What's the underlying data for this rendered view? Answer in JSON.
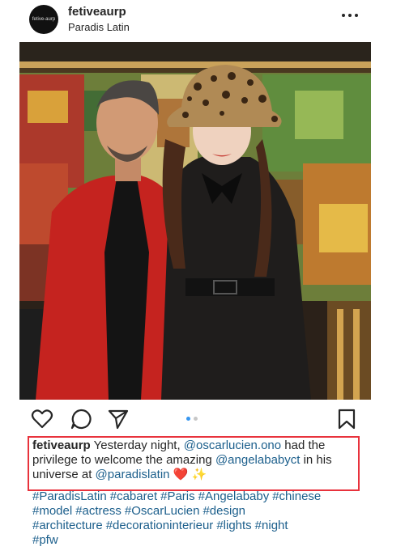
{
  "header": {
    "avatar_text": "fetive-aurp",
    "username": "fetiveaurp",
    "location": "Paradis Latin"
  },
  "icons": {
    "more": "more-horizontal-icon",
    "like": "heart-outline-icon",
    "comment": "comment-bubble-icon",
    "share": "paper-plane-icon",
    "save": "bookmark-icon"
  },
  "carousel": {
    "total": 2,
    "active": 1
  },
  "caption": {
    "username": "fetiveaurp",
    "text1": " Yesterday night, ",
    "mention1": "@oscarlucien.ono",
    "text2": " had the privilege to welcome the amazing ",
    "mention2": "@angelababyct",
    "text3": " in his universe at ",
    "mention3": "@paradislatin",
    "emoji": "❤️ ✨"
  },
  "hashtags": [
    "#ParadisLatin",
    "#cabaret",
    "#Paris",
    "#Angelababy",
    "#chinese",
    "#model",
    "#actress",
    "#OscarLucien",
    "#design",
    "#architecture",
    "#decorationinterieur",
    "#lights",
    "#night",
    "#pfw"
  ],
  "colors": {
    "link": "#1c5f8c",
    "highlight_box": "#e8323c",
    "dot_active": "#3897f0",
    "dot_inactive": "#c7c7c7",
    "text": "#262626"
  }
}
